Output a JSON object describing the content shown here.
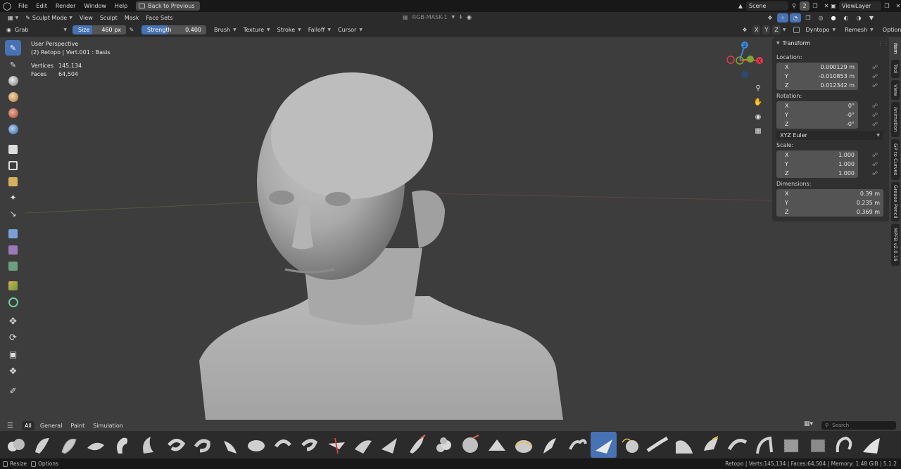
{
  "topbar": {
    "menus": [
      "File",
      "Edit",
      "Render",
      "Window",
      "Help"
    ],
    "back_label": "Back to Previous",
    "center_label": "RGB-MASK-1",
    "scene": "Scene",
    "scene_count": "2",
    "view_layer": "ViewLayer"
  },
  "modebar": {
    "mode": "Sculpt Mode",
    "menus": [
      "View",
      "Sculpt",
      "Mask",
      "Face Sets"
    ]
  },
  "toolsettings": {
    "brush": "Grab",
    "size_label": "Size",
    "size_value": "460 px",
    "strength_label": "Strength",
    "strength_value": "0.400",
    "strength_fraction": 0.4,
    "menus": [
      "Brush",
      "Texture",
      "Stroke",
      "Falloff",
      "Cursor"
    ],
    "axes": [
      "X",
      "Y",
      "Z"
    ],
    "dyntopo": "Dyntopo",
    "remesh": "Remesh",
    "options": "Options"
  },
  "viewport": {
    "perspective": "User Perspective",
    "object_info": "(2) Retopo | Vert.001 : Basis",
    "stats": [
      {
        "label": "Vertices",
        "value": "145,134"
      },
      {
        "label": "Faces",
        "value": "64,504"
      }
    ],
    "gizmo": {
      "z": "Z",
      "x": "X"
    }
  },
  "npanel": {
    "title": "Transform",
    "location_label": "Location:",
    "location": [
      {
        "axis": "X",
        "value": "0.000129 m"
      },
      {
        "axis": "Y",
        "value": "-0.010853 m"
      },
      {
        "axis": "Z",
        "value": "0.012342 m"
      }
    ],
    "rotation_label": "Rotation:",
    "rotation": [
      {
        "axis": "X",
        "value": "0°"
      },
      {
        "axis": "Y",
        "value": "-0°"
      },
      {
        "axis": "Z",
        "value": "-0°"
      }
    ],
    "rotation_mode": "XYZ Euler",
    "scale_label": "Scale:",
    "scale": [
      {
        "axis": "X",
        "value": "1.000"
      },
      {
        "axis": "Y",
        "value": "1.000"
      },
      {
        "axis": "Z",
        "value": "1.000"
      }
    ],
    "dimensions_label": "Dimensions:",
    "dimensions": [
      {
        "axis": "X",
        "value": "0.39 m"
      },
      {
        "axis": "Y",
        "value": "0.235 m"
      },
      {
        "axis": "Z",
        "value": "0.369 m"
      }
    ]
  },
  "vtabs": [
    "Item",
    "Tool",
    "View",
    "Animation",
    "GP to Curves",
    "Grease Pencil",
    "MPFB v2.0.16"
  ],
  "shelf": {
    "tabs": [
      "All",
      "General",
      "Paint",
      "Simulation"
    ],
    "search_placeholder": "Search"
  },
  "statusbar": {
    "left": [
      "Resize",
      "Options"
    ],
    "right": "Retopo | Verts:145,134 | Faces:64,504 | Memory: 1.48 GiB | 5.1.2"
  },
  "colors": {
    "accent": "#4772b3",
    "x_axis": "#e0394a",
    "y_axis": "#7aa82e",
    "z_axis": "#3d86d8"
  }
}
